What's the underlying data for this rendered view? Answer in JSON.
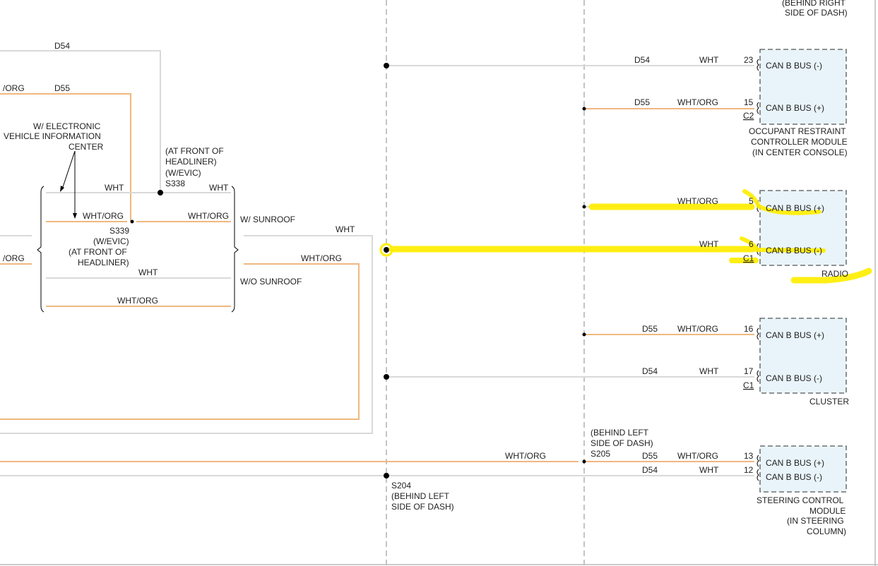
{
  "labels": {
    "top_right_1": "(BEHIND RIGHT",
    "top_right_2": "SIDE OF DASH)",
    "d54_top": "D54",
    "d55_top": "D55",
    "wht_org_left_top": "/ORG",
    "wht_org_left_mid": "/ORG",
    "evic_1": "W/ ELECTRONIC",
    "evic_2": "VEHICLE INFORMATION",
    "evic_3": "CENTER",
    "s338_1": "(AT FRONT OF",
    "s338_2": "HEADLINER)",
    "s338_3": "(W/EVIC)",
    "s338_4": "S338",
    "s339_1": "S339",
    "s339_2": "(W/EVIC)",
    "s339_3": "(AT FRONT OF",
    "s339_4": "HEADLINER)",
    "w_sunroof": "W/ SUNROOF",
    "wo_sunroof": "W/O SUNROOF",
    "wht": "WHT",
    "wht_org": "WHT/ORG",
    "d54": "D54",
    "d55": "D55",
    "s205_1": "(BEHIND LEFT",
    "s205_2": "SIDE OF DASH)",
    "s205_3": "S205",
    "s204_1": "S204",
    "s204_2": "(BEHIND LEFT",
    "s204_3": "SIDE OF DASH)"
  },
  "modules": {
    "orc": {
      "pin_a": "23",
      "sig_a": "CAN B BUS (-)",
      "pin_b": "15",
      "sig_b": "CAN B BUS (+)",
      "connector": "C2",
      "name_1": "OCCUPANT RESTRAINT",
      "name_2": "CONTROLLER MODULE",
      "name_3": "(IN CENTER CONSOLE)"
    },
    "radio": {
      "pin_a": "5",
      "sig_a": "CAN B BUS (+)",
      "pin_b": "6",
      "sig_b": "CAN B BUS (-)",
      "connector": "C1",
      "name_1": "RADIO"
    },
    "cluster": {
      "pin_a": "16",
      "sig_a": "CAN B BUS (+)",
      "pin_b": "17",
      "sig_b": "CAN B BUS (-)",
      "connector": "C1",
      "name_1": "CLUSTER"
    },
    "sccm": {
      "pin_a": "13",
      "sig_a": "CAN B BUS (+)",
      "pin_b": "12",
      "sig_b": "CAN B BUS (-)",
      "name_1": "STEERING CONTROL",
      "name_2": "MODULE",
      "name_3": "(IN STEERING",
      "name_4": "COLUMN)"
    }
  },
  "colors": {
    "wht_wire": "#d9d9d9",
    "wht_org_wire": "#f0b880",
    "module_fill": "#e9f4fa",
    "highlight": "#ffee00"
  }
}
